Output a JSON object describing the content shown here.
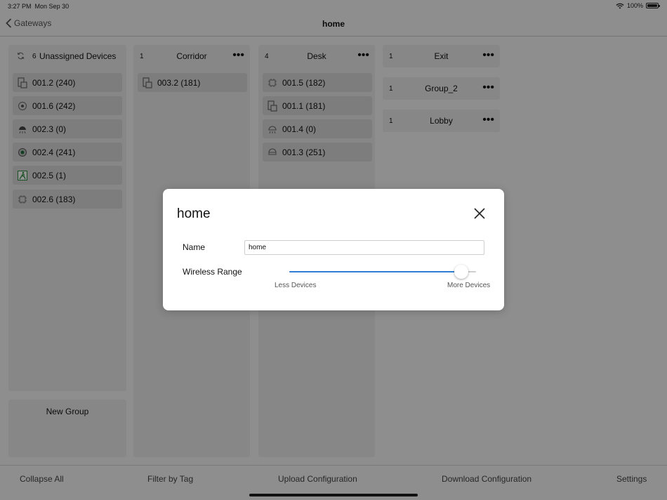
{
  "status": {
    "time": "3:27 PM",
    "date": "Mon Sep 30",
    "battery": "100%"
  },
  "nav": {
    "back_label": "Gateways",
    "title": "home"
  },
  "columns": [
    {
      "count": "6",
      "title": "Unassigned Devices",
      "devices": [
        {
          "label": "001.2 (240)",
          "icon": "switch-device-icon"
        },
        {
          "label": "001.6 (242)",
          "icon": "sensor-device-icon"
        },
        {
          "label": "002.3 (0)",
          "icon": "light-fixture-icon"
        },
        {
          "label": "002.4 (241)",
          "icon": "occupancy-sensor-icon"
        },
        {
          "label": "002.5 (1)",
          "icon": "exit-sign-icon"
        },
        {
          "label": "002.6 (183)",
          "icon": "controller-device-icon"
        }
      ]
    },
    {
      "count": "1",
      "title": "Corridor",
      "devices": [
        {
          "label": "003.2 (181)",
          "icon": "switch-device-icon"
        }
      ]
    },
    {
      "count": "4",
      "title": "Desk",
      "devices": [
        {
          "label": "001.5 (182)",
          "icon": "controller-device-icon"
        },
        {
          "label": "001.1 (181)",
          "icon": "switch-device-icon"
        },
        {
          "label": "001.4 (0)",
          "icon": "light-fixture-icon"
        },
        {
          "label": "001.3 (251)",
          "icon": "ceiling-light-icon"
        }
      ]
    },
    {
      "count": "1",
      "title": "Exit",
      "devices": []
    },
    {
      "count": "1",
      "title": "Group_2",
      "devices": []
    },
    {
      "count": "1",
      "title": "Lobby",
      "devices": []
    }
  ],
  "new_group_label": "New Group",
  "toolbar": {
    "collapse_all": "Collapse All",
    "filter_by_tag": "Filter by Tag",
    "upload_configuration": "Upload Configuration",
    "download_configuration": "Download Configuration",
    "settings": "Settings"
  },
  "modal": {
    "title": "home",
    "name_label": "Name",
    "name_value": "home",
    "wireless_range_label": "Wireless Range",
    "wireless_range_value": 0.92,
    "min_label": "Less Devices",
    "max_label": "More Devices"
  },
  "colors": {
    "accent": "#2e7fd4",
    "overlay": "rgba(0,0,0,0.42)"
  }
}
